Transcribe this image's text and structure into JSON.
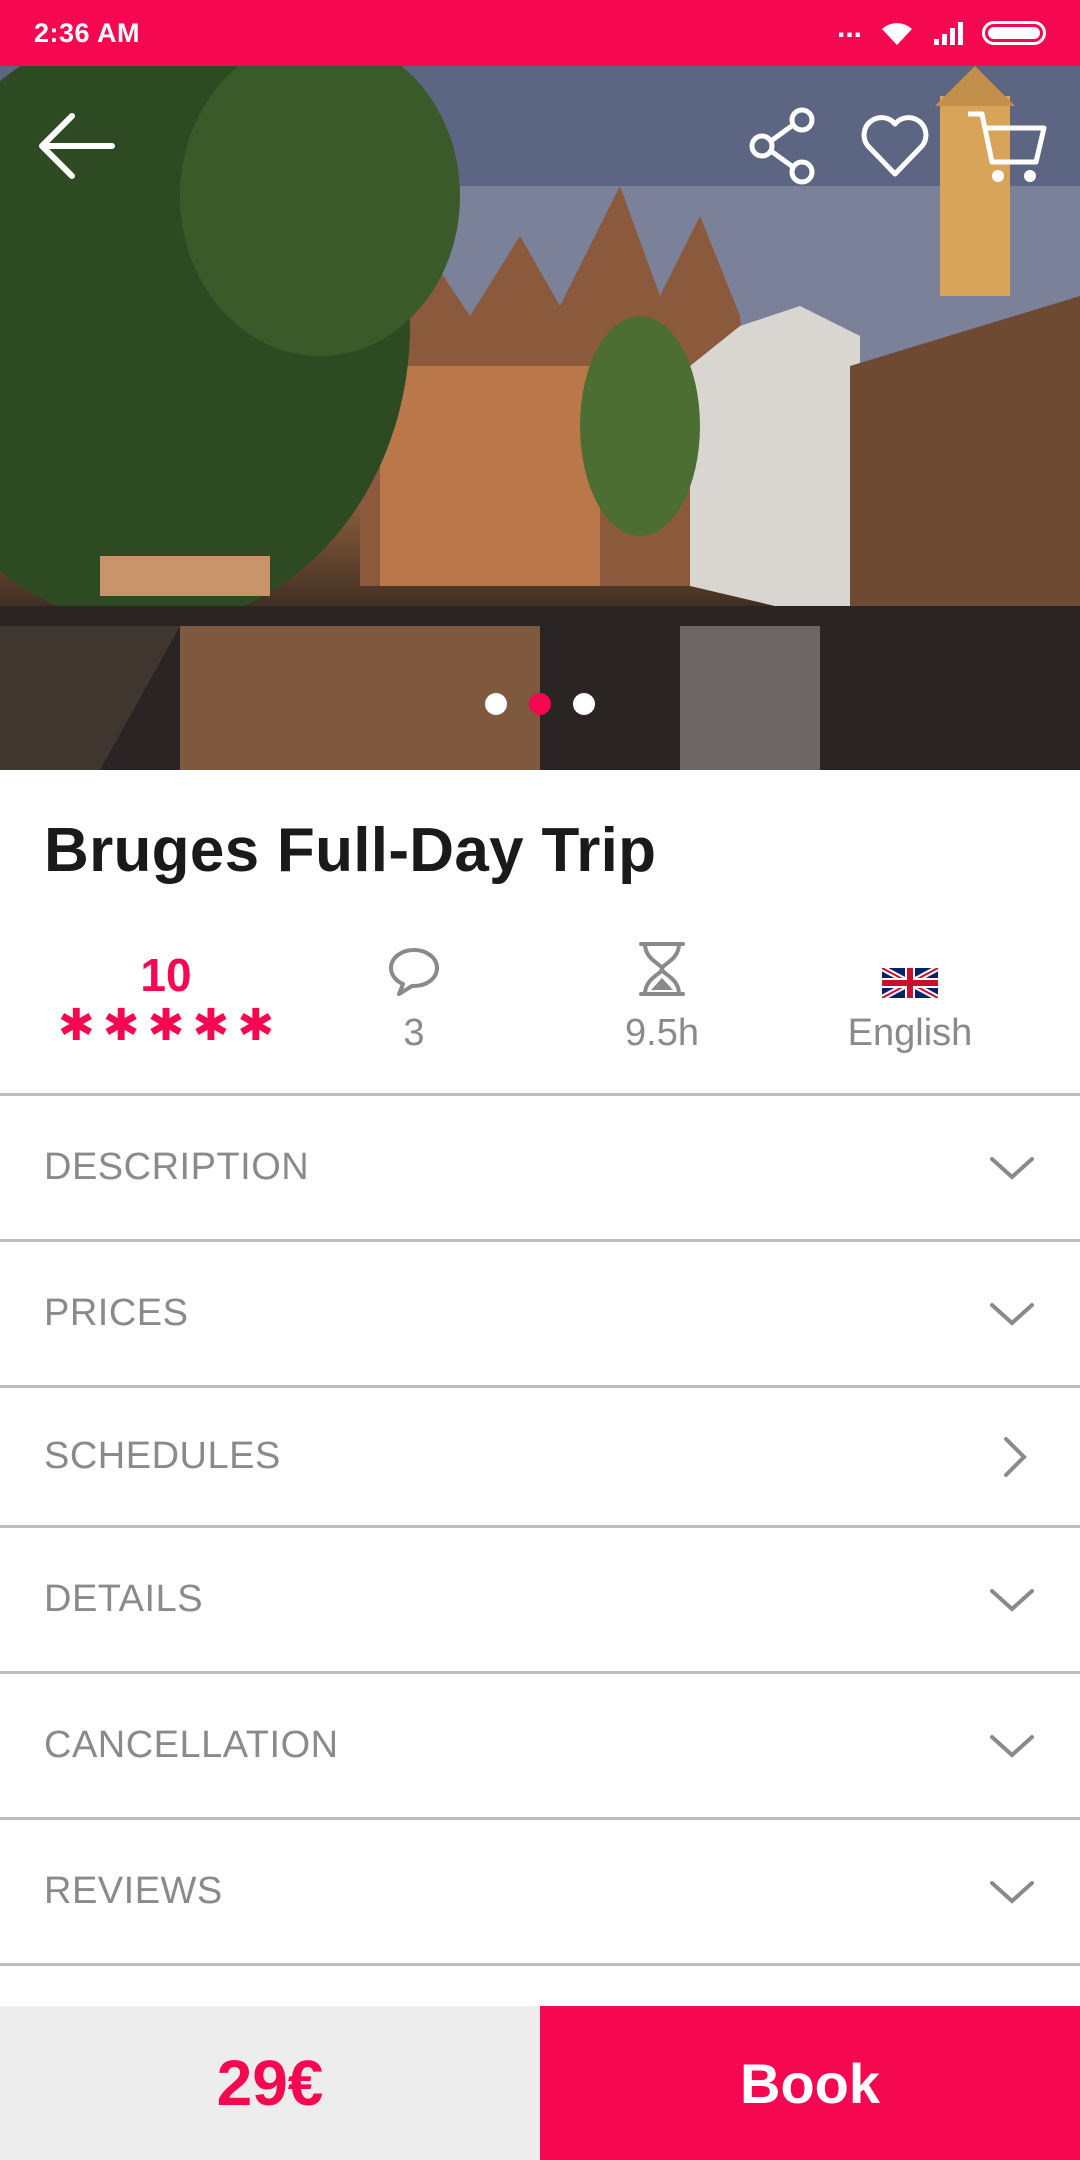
{
  "status_bar": {
    "time": "2:36 AM",
    "dots": "...",
    "icons": [
      "wifi-icon",
      "signal-icon",
      "battery-icon"
    ]
  },
  "header": {
    "icons": [
      "back-arrow-icon",
      "share-icon",
      "heart-icon",
      "cart-icon"
    ]
  },
  "carousel": {
    "slide_count": 3,
    "active_index": 1
  },
  "tour": {
    "title": "Bruges Full-Day Trip"
  },
  "stats": {
    "rating": "10",
    "stars": 5,
    "reviews": "3",
    "duration": "9.5h",
    "language": "English"
  },
  "sections": [
    {
      "label": "DESCRIPTION",
      "icon": "chevron-down-icon"
    },
    {
      "label": "PRICES",
      "icon": "chevron-down-icon"
    },
    {
      "label": "SCHEDULES",
      "icon": "chevron-right-icon"
    },
    {
      "label": "DETAILS",
      "icon": "chevron-down-icon"
    },
    {
      "label": "CANCELLATION",
      "icon": "chevron-down-icon"
    },
    {
      "label": "REVIEWS",
      "icon": "chevron-down-icon"
    }
  ],
  "footer": {
    "price": "29€",
    "book_label": "Book"
  },
  "colors": {
    "accent": "#f5084f",
    "text_muted": "#8a8a8a",
    "divider": "#bdbdbd",
    "price_bg": "#ededed"
  }
}
